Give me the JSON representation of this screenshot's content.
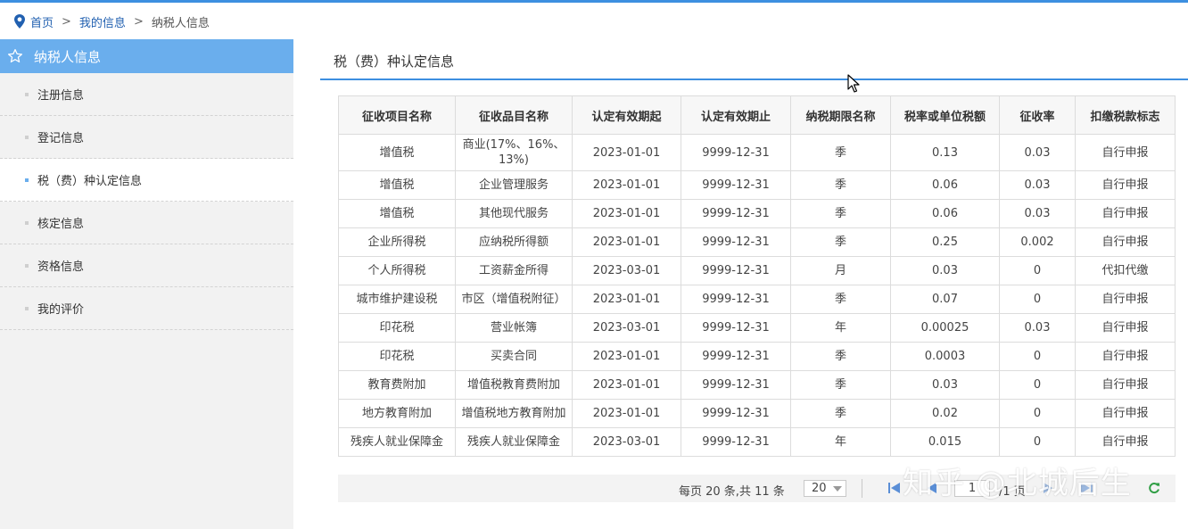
{
  "breadcrumb": {
    "home": "首页",
    "separator": ">",
    "my_info": "我的信息",
    "current": "纳税人信息"
  },
  "sidebar": {
    "title": "纳税人信息",
    "items": [
      {
        "label": "注册信息"
      },
      {
        "label": "登记信息"
      },
      {
        "label": "税（费）种认定信息"
      },
      {
        "label": "核定信息"
      },
      {
        "label": "资格信息"
      },
      {
        "label": "我的评价"
      }
    ]
  },
  "content": {
    "title": "税（费）种认定信息"
  },
  "table": {
    "columns": [
      "征收项目名称",
      "征收品目名称",
      "认定有效期起",
      "认定有效期止",
      "纳税期限名称",
      "税率或单位税额",
      "征收率",
      "扣缴税款标志"
    ],
    "rows": [
      [
        "增值税",
        "商业(17%、16%、13%)",
        "2023-01-01",
        "9999-12-31",
        "季",
        "0.13",
        "0.03",
        "自行申报"
      ],
      [
        "增值税",
        "企业管理服务",
        "2023-01-01",
        "9999-12-31",
        "季",
        "0.06",
        "0.03",
        "自行申报"
      ],
      [
        "增值税",
        "其他现代服务",
        "2023-01-01",
        "9999-12-31",
        "季",
        "0.06",
        "0.03",
        "自行申报"
      ],
      [
        "企业所得税",
        "应纳税所得额",
        "2023-01-01",
        "9999-12-31",
        "季",
        "0.25",
        "0.002",
        "自行申报"
      ],
      [
        "个人所得税",
        "工资薪金所得",
        "2023-03-01",
        "9999-12-31",
        "月",
        "0.03",
        "0",
        "代扣代缴"
      ],
      [
        "城市维护建设税",
        "市区（增值税附征）",
        "2023-01-01",
        "9999-12-31",
        "季",
        "0.07",
        "0",
        "自行申报"
      ],
      [
        "印花税",
        "营业帐簿",
        "2023-03-01",
        "9999-12-31",
        "年",
        "0.00025",
        "0.03",
        "自行申报"
      ],
      [
        "印花税",
        "买卖合同",
        "2023-01-01",
        "9999-12-31",
        "季",
        "0.0003",
        "0",
        "自行申报"
      ],
      [
        "教育费附加",
        "增值税教育费附加",
        "2023-01-01",
        "9999-12-31",
        "季",
        "0.03",
        "0",
        "自行申报"
      ],
      [
        "地方教育附加",
        "增值税地方教育附加",
        "2023-01-01",
        "9999-12-31",
        "季",
        "0.02",
        "0",
        "自行申报"
      ],
      [
        "残疾人就业保障金",
        "残疾人就业保障金",
        "2023-03-01",
        "9999-12-31",
        "年",
        "0.015",
        "0",
        "自行申报"
      ]
    ]
  },
  "pager": {
    "summary": "每页 20 条,共 11 条",
    "page_size": "20",
    "current_page": "1",
    "total_pages": "/1 页"
  },
  "watermark": "知乎 @北城后生",
  "colors": {
    "accent": "#3d8fe0",
    "sidebar_header": "#6aaeed",
    "sidebar_bg": "#f2f2f2",
    "link": "#2160b0"
  }
}
